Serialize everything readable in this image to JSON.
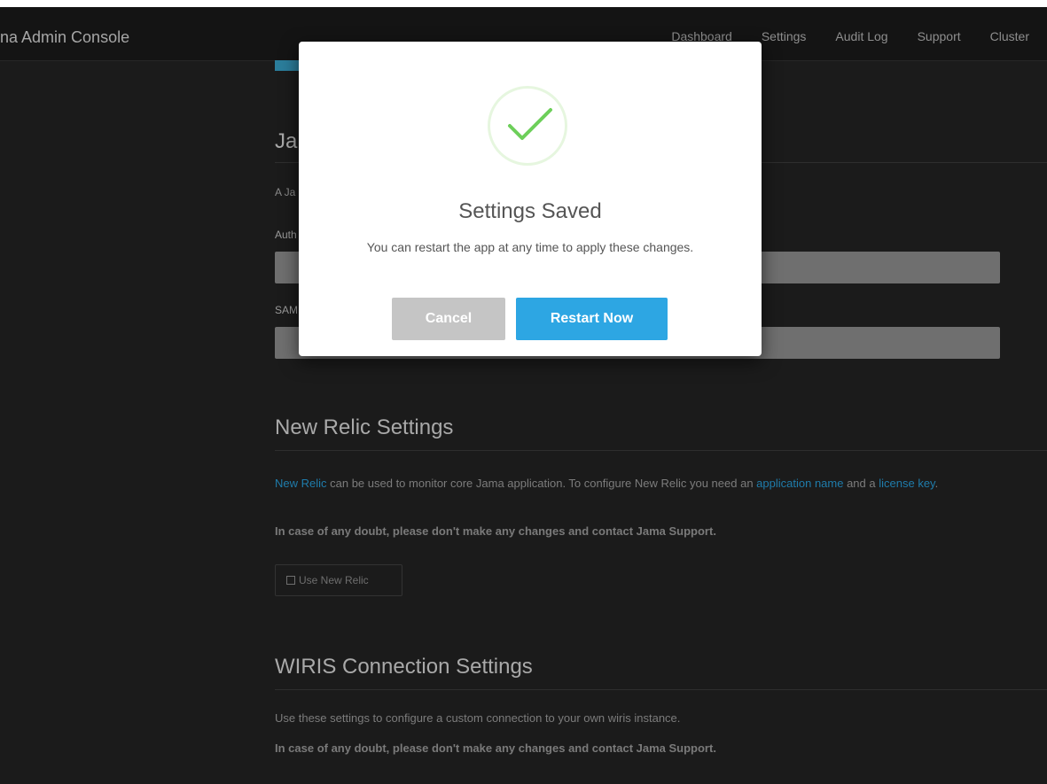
{
  "app": {
    "title": "na Admin Console"
  },
  "nav": [
    {
      "label": "Dashboard"
    },
    {
      "label": "Settings"
    },
    {
      "label": "Audit Log"
    },
    {
      "label": "Support"
    },
    {
      "label": "Cluster"
    }
  ],
  "jama_section": {
    "heading_visible": "Ja",
    "desc_visible": "A Ja",
    "auth_label_visible": "Auth",
    "saml_label_visible": "SAM"
  },
  "new_relic": {
    "heading": "New Relic Settings",
    "link_new_relic": "New Relic",
    "text_1": " can be used to monitor core Jama application. To configure New Relic you need an ",
    "link_app_name": "application name",
    "text_2": " and a ",
    "link_license_key": "license key",
    "text_3": ".",
    "warning": "In case of any doubt, please don't make any changes and contact Jama Support.",
    "checkbox_label": "Use New Relic"
  },
  "wiris": {
    "heading": "WIRIS Connection Settings",
    "description": "Use these settings to configure a custom connection to your own wiris instance.",
    "warning": "In case of any doubt, please don't make any changes and contact Jama Support."
  },
  "modal": {
    "icon": "check-icon",
    "title": "Settings Saved",
    "message": "You can restart the app at any time to apply these changes.",
    "cancel_label": "Cancel",
    "restart_label": "Restart Now"
  },
  "colors": {
    "accent_blue": "#2da6e3",
    "link_blue": "#1f7cab",
    "check_green": "#6dcf5a"
  }
}
